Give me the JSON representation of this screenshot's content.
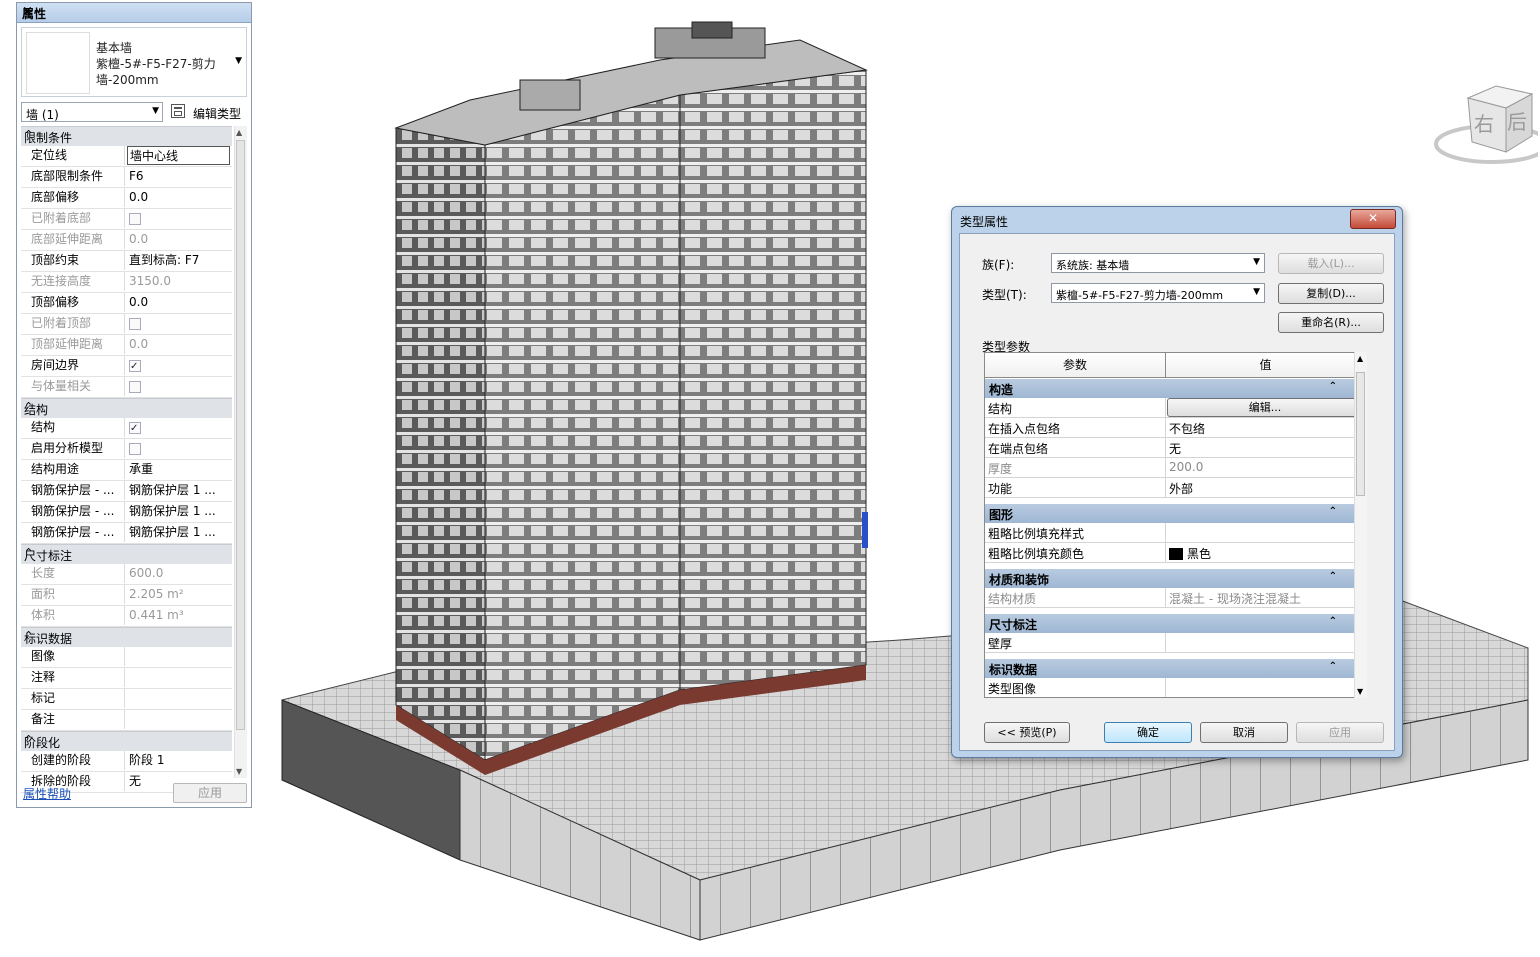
{
  "viewcube": {
    "face_right": "右",
    "face_back": "后"
  },
  "properties": {
    "title": "属性",
    "close": "×",
    "type_family": "基本墙",
    "type_name_line1": "紫檀-5#-F5-F27-剪力",
    "type_name_line2": "墙-200mm",
    "instance_filter": "墙 (1)",
    "edit_type": "编辑类型",
    "groups": [
      {
        "name": "限制条件",
        "rows": [
          {
            "n": "定位线",
            "v": "墙中心线",
            "dis": false,
            "sel": true
          },
          {
            "n": "底部限制条件",
            "v": "F6"
          },
          {
            "n": "底部偏移",
            "v": "0.0"
          },
          {
            "n": "已附着底部",
            "cb": false,
            "dis": true
          },
          {
            "n": "底部延伸距离",
            "v": "0.0",
            "dis": true
          },
          {
            "n": "顶部约束",
            "v": "直到标高: F7"
          },
          {
            "n": "无连接高度",
            "v": "3150.0",
            "dis": true
          },
          {
            "n": "顶部偏移",
            "v": "0.0"
          },
          {
            "n": "已附着顶部",
            "cb": false,
            "dis": true
          },
          {
            "n": "顶部延伸距离",
            "v": "0.0",
            "dis": true
          },
          {
            "n": "房间边界",
            "cb": true
          },
          {
            "n": "与体量相关",
            "cb": false,
            "dis": true
          }
        ]
      },
      {
        "name": "结构",
        "rows": [
          {
            "n": "结构",
            "cb": true
          },
          {
            "n": "启用分析模型",
            "cb": false
          },
          {
            "n": "结构用途",
            "v": "承重"
          },
          {
            "n": "钢筋保护层 - ...",
            "v": "钢筋保护层 1 ..."
          },
          {
            "n": "钢筋保护层 - ...",
            "v": "钢筋保护层 1 ..."
          },
          {
            "n": "钢筋保护层 - ...",
            "v": "钢筋保护层 1 ..."
          }
        ]
      },
      {
        "name": "尺寸标注",
        "rows": [
          {
            "n": "长度",
            "v": "600.0",
            "dis": true
          },
          {
            "n": "面积",
            "v": "2.205 m²",
            "dis": true
          },
          {
            "n": "体积",
            "v": "0.441 m³",
            "dis": true
          }
        ]
      },
      {
        "name": "标识数据",
        "rows": [
          {
            "n": "图像",
            "v": ""
          },
          {
            "n": "注释",
            "v": ""
          },
          {
            "n": "标记",
            "v": ""
          },
          {
            "n": "备注",
            "v": ""
          }
        ]
      },
      {
        "name": "阶段化",
        "rows": [
          {
            "n": "创建的阶段",
            "v": "阶段 1"
          },
          {
            "n": "拆除的阶段",
            "v": "无"
          }
        ]
      }
    ],
    "help_link": "属性帮助",
    "apply": "应用"
  },
  "dialog": {
    "title": "类型属性",
    "close": "✕",
    "family_label": "族(F):",
    "family_value": "系统族: 基本墙",
    "type_label": "类型(T):",
    "type_value": "紫檀-5#-F5-F27-剪力墙-200mm",
    "load_btn": "载入(L)...",
    "duplicate_btn": "复制(D)...",
    "rename_btn": "重命名(R)...",
    "params_caption": "类型参数",
    "col_param": "参数",
    "col_value": "值",
    "groups": [
      {
        "name": "构造",
        "rows": [
          {
            "n": "结构",
            "v": "编辑...",
            "btn": true
          },
          {
            "n": "在插入点包络",
            "v": "不包络"
          },
          {
            "n": "在端点包络",
            "v": "无"
          },
          {
            "n": "厚度",
            "v": "200.0",
            "dis": true
          },
          {
            "n": "功能",
            "v": "外部"
          }
        ]
      },
      {
        "name": "图形",
        "rows": [
          {
            "n": "粗略比例填充样式",
            "v": ""
          },
          {
            "n": "粗略比例填充颜色",
            "v": "黑色",
            "swatch": "#000000"
          }
        ]
      },
      {
        "name": "材质和装饰",
        "rows": [
          {
            "n": "结构材质",
            "v": "混凝土 - 现场浇注混凝土",
            "dis": true
          }
        ]
      },
      {
        "name": "尺寸标注",
        "rows": [
          {
            "n": "壁厚",
            "v": ""
          }
        ]
      },
      {
        "name": "标识数据",
        "rows": [
          {
            "n": "类型图像",
            "v": ""
          }
        ]
      }
    ],
    "preview_btn": "<< 预览(P)",
    "ok_btn": "确定",
    "cancel_btn": "取消",
    "apply_btn": "应用"
  }
}
